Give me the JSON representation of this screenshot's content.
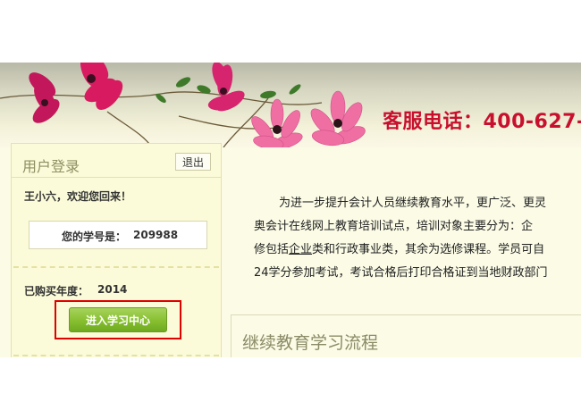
{
  "header": {
    "hotline": "客服电话：400-627-"
  },
  "login_panel": {
    "title": "用户登录",
    "logout_label": "退出",
    "welcome": "王小六，欢迎您回来！",
    "student_id_label": "您的学号是：",
    "student_id_value": "209988",
    "purchase_label": "已购买年度：",
    "purchase_year": "2014",
    "enter_button_label": "进入学习中心"
  },
  "intro": {
    "line1": "为进一步提升会计人员继续教育水平，更广泛、更灵",
    "line2": "奥会计在线网上教育培训试点，培训对象主要分为：企",
    "line3_a": "修包括",
    "line3_b": "企业",
    "line3_c": "类和",
    "line3_d": "行政事业",
    "line3_e": "类，其余为选修课程。学员可自",
    "line4": "24学分参加考试，考试合格后打印合格证到当地财政部门"
  },
  "flow_section": {
    "title": "继续教育学习流程"
  },
  "colors": {
    "hotline": "#c8102e",
    "highlight_border": "#e00000",
    "button_green": "#86bf2f",
    "panel_bg": "#fbfbd9"
  }
}
